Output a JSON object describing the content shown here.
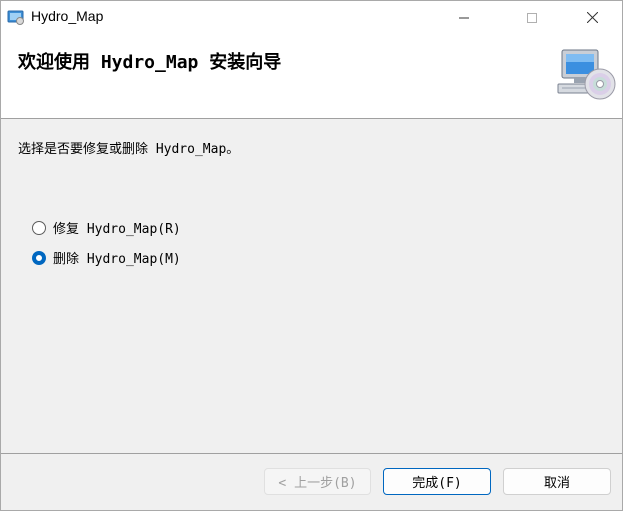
{
  "window": {
    "title": "Hydro_Map",
    "controls": [
      "minimize-icon",
      "maximize-icon",
      "close-icon"
    ]
  },
  "banner": {
    "title": "欢迎使用 Hydro_Map 安装向导",
    "icon": "computer-disc-icon"
  },
  "body": {
    "instruction": "选择是否要修复或删除 Hydro_Map。",
    "options": [
      {
        "label": "修复 Hydro_Map(R)",
        "selected": false
      },
      {
        "label": "删除 Hydro_Map(M)",
        "selected": true
      }
    ]
  },
  "footer": {
    "back_label": "< 上一步(B)",
    "finish_label": "完成(F)",
    "cancel_label": "取消"
  },
  "colors": {
    "accent": "#0067c0",
    "background": "#f0f0f0",
    "banner": "#ffffff"
  }
}
